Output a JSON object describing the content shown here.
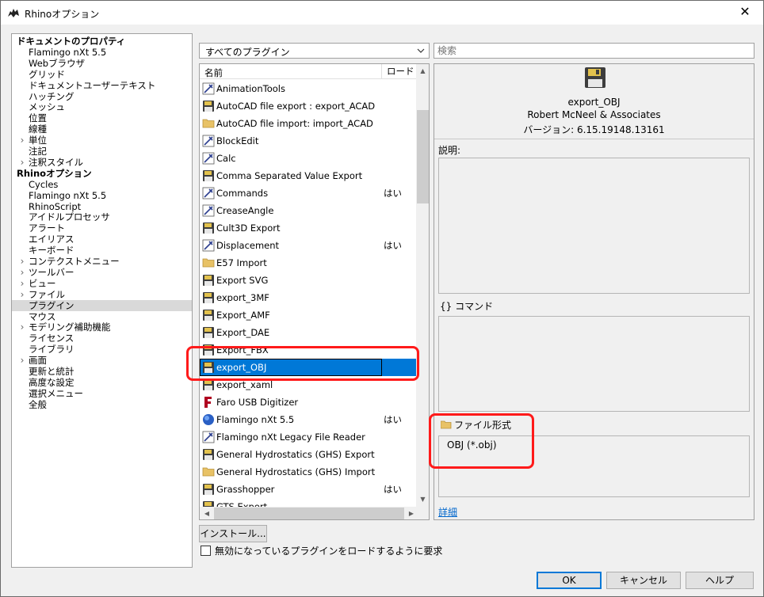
{
  "window": {
    "title": "Rhinoオプション",
    "close": "✕"
  },
  "tree": [
    {
      "label": "ドキュメントのプロパティ",
      "level": 0,
      "bold": true
    },
    {
      "label": "Flamingo nXt 5.5",
      "level": 1
    },
    {
      "label": "Webブラウザ",
      "level": 1
    },
    {
      "label": "グリッド",
      "level": 1
    },
    {
      "label": "ドキュメントユーザーテキスト",
      "level": 1
    },
    {
      "label": "ハッチング",
      "level": 1
    },
    {
      "label": "メッシュ",
      "level": 1
    },
    {
      "label": "位置",
      "level": 1
    },
    {
      "label": "線種",
      "level": 1
    },
    {
      "label": "単位",
      "level": 1,
      "expandable": true
    },
    {
      "label": "注記",
      "level": 1
    },
    {
      "label": "注釈スタイル",
      "level": 1,
      "expandable": true
    },
    {
      "label": "Rhinoオプション",
      "level": 0,
      "bold": true
    },
    {
      "label": "Cycles",
      "level": 1
    },
    {
      "label": "Flamingo nXt 5.5",
      "level": 1
    },
    {
      "label": "RhinoScript",
      "level": 1
    },
    {
      "label": "アイドルプロセッサ",
      "level": 1
    },
    {
      "label": "アラート",
      "level": 1
    },
    {
      "label": "エイリアス",
      "level": 1
    },
    {
      "label": "キーボード",
      "level": 1
    },
    {
      "label": "コンテクストメニュー",
      "level": 1,
      "expandable": true
    },
    {
      "label": "ツールバー",
      "level": 1,
      "expandable": true
    },
    {
      "label": "ビュー",
      "level": 1,
      "expandable": true
    },
    {
      "label": "ファイル",
      "level": 1,
      "expandable": true
    },
    {
      "label": "プラグイン",
      "level": 1,
      "selected": true
    },
    {
      "label": "マウス",
      "level": 1
    },
    {
      "label": "モデリング補助機能",
      "level": 1,
      "expandable": true
    },
    {
      "label": "ライセンス",
      "level": 1
    },
    {
      "label": "ライブラリ",
      "level": 1
    },
    {
      "label": "画面",
      "level": 1,
      "expandable": true
    },
    {
      "label": "更新と統計",
      "level": 1
    },
    {
      "label": "高度な設定",
      "level": 1
    },
    {
      "label": "選択メニュー",
      "level": 1
    },
    {
      "label": "全般",
      "level": 1
    }
  ],
  "filter": {
    "value": "すべてのプラグイン"
  },
  "search": {
    "placeholder": "検索"
  },
  "list": {
    "headers": {
      "name": "名前",
      "load": "ロード"
    },
    "rows": [
      {
        "name": "AnimationTools",
        "icon": "tool",
        "load": ""
      },
      {
        "name": "AutoCAD file export : export_ACAD",
        "icon": "save",
        "load": ""
      },
      {
        "name": "AutoCAD file import: import_ACAD",
        "icon": "folder",
        "load": ""
      },
      {
        "name": "BlockEdit",
        "icon": "tool",
        "load": ""
      },
      {
        "name": "Calc",
        "icon": "tool",
        "load": ""
      },
      {
        "name": "Comma Separated Value Export",
        "icon": "save",
        "load": ""
      },
      {
        "name": "Commands",
        "icon": "tool",
        "load": "はい"
      },
      {
        "name": "CreaseAngle",
        "icon": "tool",
        "load": ""
      },
      {
        "name": "Cult3D Export",
        "icon": "save",
        "load": ""
      },
      {
        "name": "Displacement",
        "icon": "tool",
        "load": "はい"
      },
      {
        "name": "E57 Import",
        "icon": "folder",
        "load": ""
      },
      {
        "name": "Export SVG",
        "icon": "save",
        "load": ""
      },
      {
        "name": "export_3MF",
        "icon": "save",
        "load": ""
      },
      {
        "name": "Export_AMF",
        "icon": "save",
        "load": ""
      },
      {
        "name": "Export_DAE",
        "icon": "save",
        "load": ""
      },
      {
        "name": "Export_FBX",
        "icon": "save",
        "load": ""
      },
      {
        "name": "export_OBJ",
        "icon": "save",
        "load": "",
        "selected": true
      },
      {
        "name": "export_xaml",
        "icon": "save",
        "load": ""
      },
      {
        "name": "Faro USB Digitizer",
        "icon": "faro",
        "load": ""
      },
      {
        "name": "Flamingo nXt 5.5",
        "icon": "globe",
        "load": "はい"
      },
      {
        "name": "Flamingo nXt Legacy File Reader",
        "icon": "tool",
        "load": ""
      },
      {
        "name": "General Hydrostatics (GHS) Export",
        "icon": "save",
        "load": ""
      },
      {
        "name": "General Hydrostatics (GHS) Import",
        "icon": "folder",
        "load": ""
      },
      {
        "name": "Grasshopper",
        "icon": "save",
        "load": "はい"
      },
      {
        "name": "GTS Export",
        "icon": "save",
        "load": ""
      }
    ]
  },
  "detail": {
    "name": "export_OBJ",
    "author": "Robert McNeel & Associates",
    "version": "バージョン: 6.15.19148.13161",
    "description_label": "説明:",
    "commands_label": "{} コマンド",
    "file_formats_label": "ファイル形式",
    "file_formats": [
      "OBJ (*.obj)"
    ],
    "details_link": "詳細"
  },
  "install_button": "インストール...",
  "load_disabled_label": "無効になっているプラグインをロードするように要求",
  "buttons": {
    "ok": "OK",
    "cancel": "キャンセル",
    "help": "ヘルプ"
  },
  "colors": {
    "selection": "#0078d7",
    "annotation": "#ff1a1a"
  }
}
